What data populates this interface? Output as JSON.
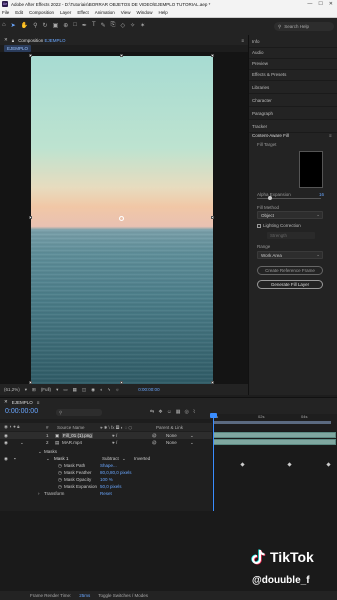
{
  "app": {
    "title": "Adobe After Effects 2022 - D:\\Tutoriais\\BORRAR OBJETOS DE VIDEO\\EJEMPLO TUTORIAL.aep *",
    "logo_text": "Ae"
  },
  "menu": [
    "File",
    "Edit",
    "Composition",
    "Layer",
    "Effect",
    "Animation",
    "View",
    "Window",
    "Help"
  ],
  "toolbar": {
    "search_placeholder": "Search Help"
  },
  "composition": {
    "tab_prefix": "Composition",
    "tab_name": "EJEMPLO",
    "breadcrumb": "EJEMPLO"
  },
  "viewer_footer": {
    "zoom": "(61,2%)",
    "resolution": "(Full)",
    "timecode": "0:00:00:00"
  },
  "right_panels": [
    "Info",
    "Audio",
    "Preview",
    "Effects & Presets",
    "Libraries",
    "Character",
    "Paragraph",
    "Tracker"
  ],
  "content_aware_fill": {
    "title": "Content-Aware Fill",
    "fill_target_label": "Fill Target",
    "alpha_expansion_label": "Alpha Expansion",
    "alpha_expansion_value": "16",
    "alpha_expansion_level": 0.2,
    "fill_method_label": "Fill Method",
    "fill_method_value": "Object",
    "lighting_correction_label": "Lighting Correction",
    "strength_value": "Strength",
    "range_label": "Range",
    "range_value": "Work Area",
    "create_reference_label": "Create Reference Frame",
    "generate_fill_label": "Generate Fill Layer"
  },
  "timeline": {
    "tab_name": "EJEMPLO",
    "timecode": "0:00:00:00",
    "search_placeholder": "",
    "ruler_labels": [
      "0s",
      "02s",
      "04s"
    ],
    "columns": {
      "source_name": "Source Name",
      "parent": "Parent & Link"
    },
    "layers": [
      {
        "num": "1",
        "name": "Fill_01 (1).png",
        "parent": "None"
      },
      {
        "num": "2",
        "name": "MAR.mp4",
        "parent": "None"
      }
    ],
    "mask_group": "Masks",
    "mask": {
      "name": "Mask 1",
      "mode": "Subtract",
      "inverted_label": "Inverted"
    },
    "mask_props": [
      {
        "name": "Mask Path",
        "value": "Shape..."
      },
      {
        "name": "Mask Feather",
        "value": "80,0,80,0 pixels"
      },
      {
        "name": "Mask Opacity",
        "value": "100 %"
      },
      {
        "name": "Mask Expansion",
        "value": "50,0 pixels"
      }
    ],
    "transform_label": "Transform",
    "transform_value": "Reset",
    "footer": {
      "render_label": "Frame Render Time:",
      "render_value": "25ms",
      "toggle_label": "Toggle Switches / Modes"
    }
  },
  "overlay": {
    "brand": "TikTok",
    "handle": "@douuble_f"
  },
  "colors": {
    "accent": "#3a8dff",
    "panel_bg": "#232323",
    "track_bar": "#7fa7a0"
  }
}
